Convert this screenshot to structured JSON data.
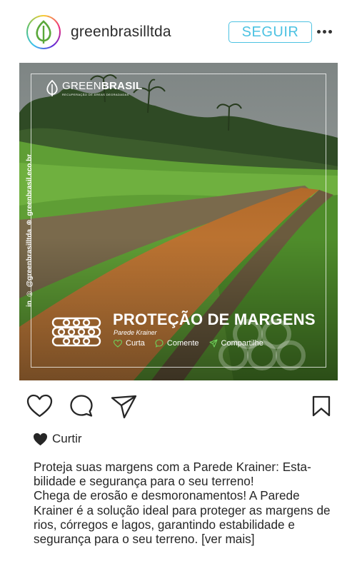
{
  "header": {
    "username": "greenbrasilltda",
    "follow_label": "SEGUIR",
    "more_icon": "more-options-icon"
  },
  "post": {
    "brand_name_light": "GREEN",
    "brand_name_bold": "BRASIL",
    "brand_tagline": "RECUPERAÇÃO DE ÁREAS DEGRADADAS",
    "side_social": "@greenbrasilltda",
    "side_site": "greenbrasil.eco.br",
    "title": "PROTEÇÃO DE MARGENS",
    "subtitle": "Parede Krainer",
    "actions": {
      "like": "Curta",
      "comment": "Comente",
      "share": "Compartilhe"
    }
  },
  "actions": {
    "like_icon": "heart-icon",
    "comment_icon": "comment-icon",
    "share_icon": "send-icon",
    "save_icon": "bookmark-icon"
  },
  "likes_label": "Curtir",
  "caption": {
    "line1": "Proteja suas margens com a Parede Krainer: Esta-bilidade e segurança para o seu terreno!",
    "line2": "Chega de erosão e desmoronamentos! A Parede Krainer é a solução ideal para proteger as margens de rios, córregos e lagos, garantindo estabilidade e segurança para o seu terreno.",
    "more": "[ver mais]"
  },
  "colors": {
    "accent": "#4cc2e2",
    "text": "#262626",
    "water": "#c9782f",
    "grass": "#5f9e35"
  }
}
